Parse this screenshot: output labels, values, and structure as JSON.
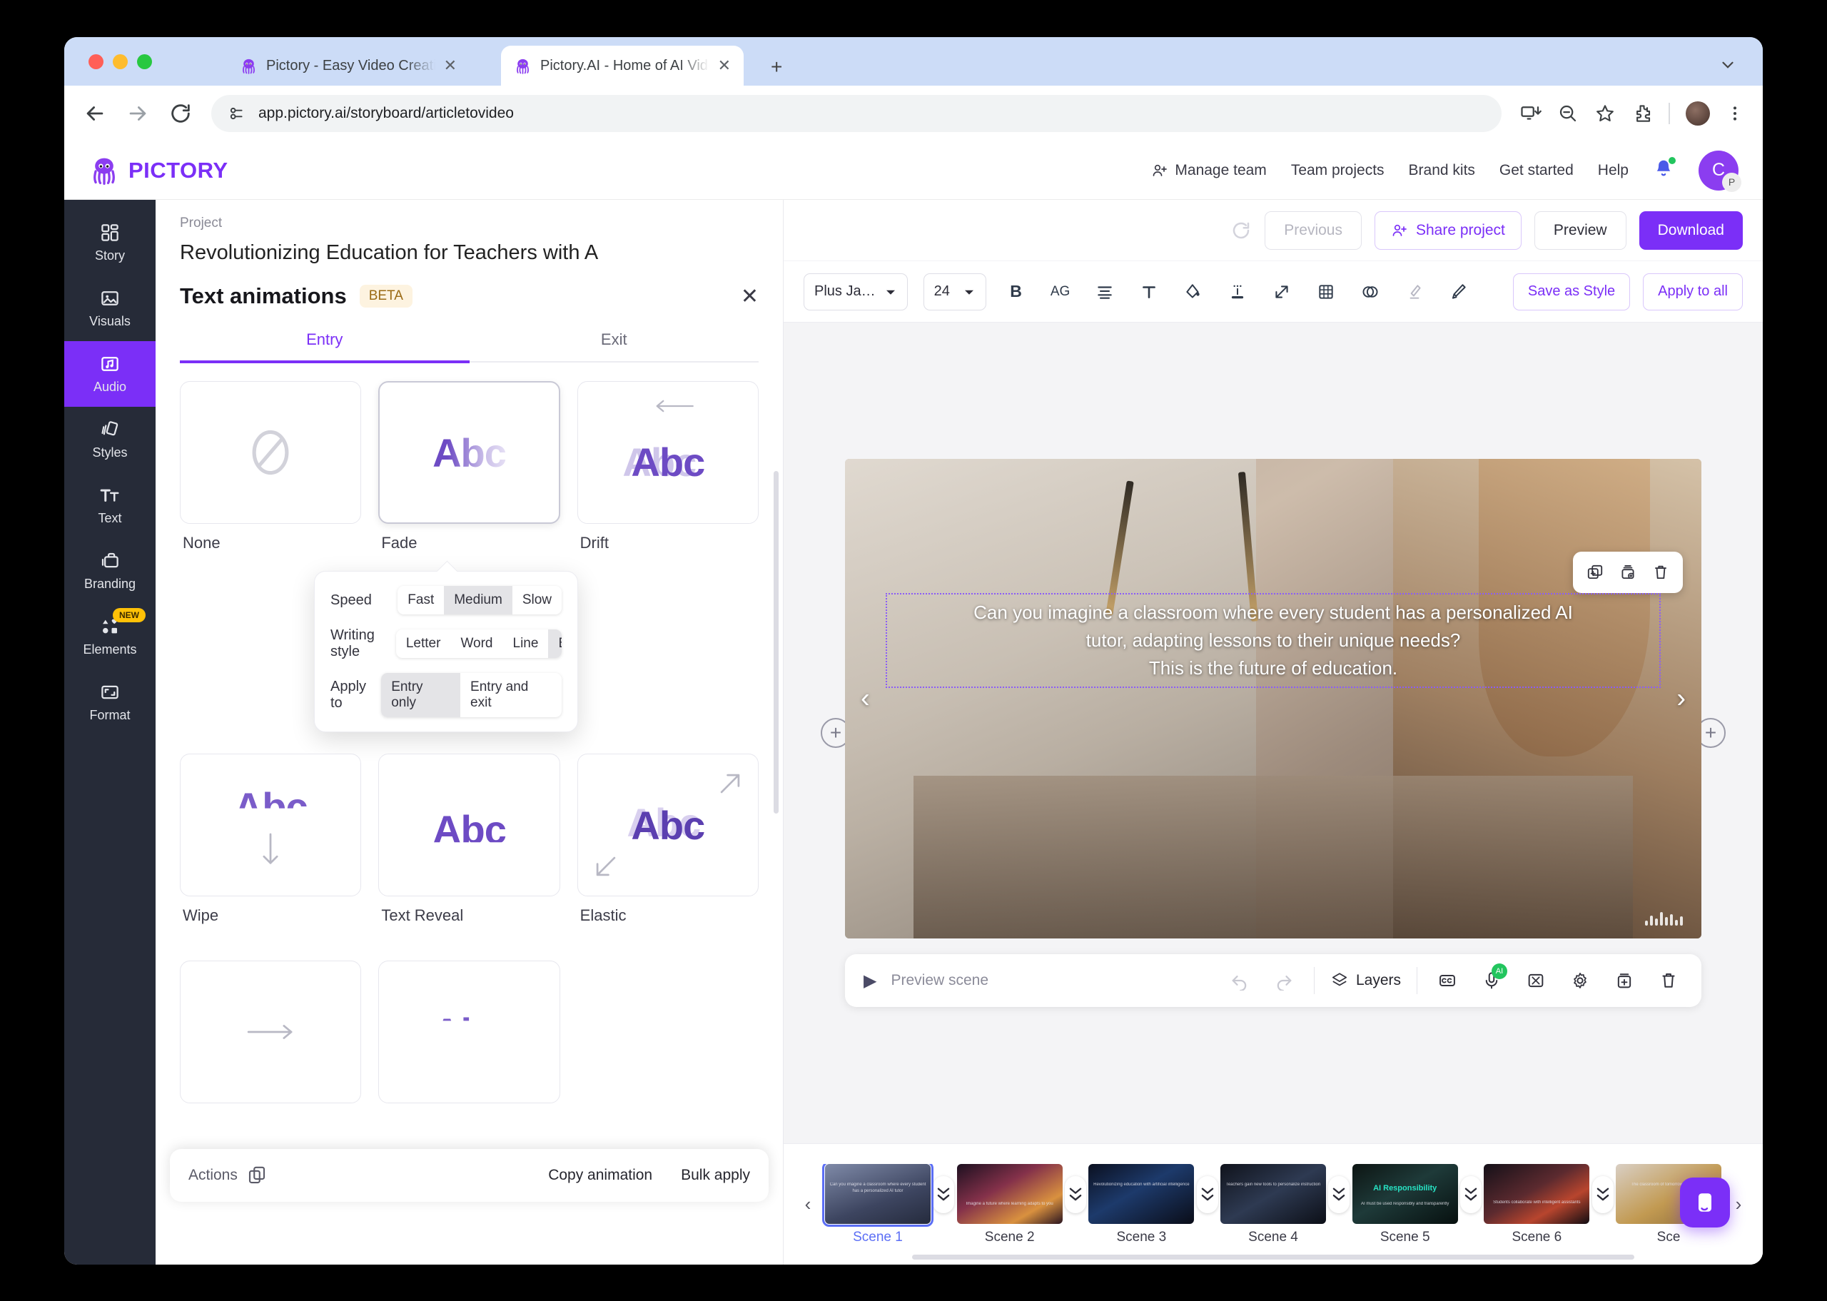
{
  "browser": {
    "tabs": [
      {
        "title": "Pictory - Easy Video Creation",
        "active": false
      },
      {
        "title": "Pictory.AI - Home of AI Video",
        "active": true
      }
    ],
    "newtab_label": "+",
    "url": "app.pictory.ai/storyboard/articletovideo",
    "back_icon": "back-arrow-icon",
    "forward_icon": "forward-arrow-icon",
    "reload_icon": "reload-icon",
    "site_info_icon": "site-settings-icon",
    "install_icon": "install-app-icon",
    "zoom_icon": "zoom-out-icon",
    "bookmark_icon": "star-icon",
    "extensions_icon": "puzzle-icon",
    "menu_icon": "kebab-menu-icon"
  },
  "header": {
    "brand": "PICTORY",
    "nav": [
      "Manage team",
      "Team projects",
      "Brand kits",
      "Get started",
      "Help"
    ],
    "avatar_initial": "C",
    "avatar_sub": "P"
  },
  "project": {
    "kicker": "Project",
    "title": "Revolutionizing Education for Teachers with A",
    "previous_label": "Previous",
    "share_label": "Share project",
    "preview_label": "Preview",
    "download_label": "Download"
  },
  "rail": {
    "items": [
      {
        "label": "Story",
        "icon": "grid-icon",
        "active": false,
        "badge": ""
      },
      {
        "label": "Visuals",
        "icon": "image-icon",
        "active": false,
        "badge": ""
      },
      {
        "label": "Audio",
        "icon": "music-icon",
        "active": true,
        "badge": ""
      },
      {
        "label": "Styles",
        "icon": "cards-icon",
        "active": false,
        "badge": ""
      },
      {
        "label": "Text",
        "icon": "text-size-icon",
        "active": false,
        "badge": ""
      },
      {
        "label": "Branding",
        "icon": "briefcase-icon",
        "active": false,
        "badge": ""
      },
      {
        "label": "Elements",
        "icon": "shapes-icon",
        "active": false,
        "badge": "NEW"
      },
      {
        "label": "Format",
        "icon": "frame-icon",
        "active": false,
        "badge": ""
      }
    ]
  },
  "panel": {
    "title": "Text animations",
    "beta": "BETA",
    "close_icon": "close-icon",
    "tabs": [
      {
        "label": "Entry",
        "active": true
      },
      {
        "label": "Exit",
        "active": false
      }
    ],
    "cards_row1": [
      {
        "label": "None",
        "glyph": "",
        "selected": false
      },
      {
        "label": "Fade",
        "glyph": "Abc",
        "selected": true
      },
      {
        "label": "Drift",
        "glyph": "Abc",
        "selected": false
      }
    ],
    "cards_row2": [
      {
        "label": "Wipe",
        "glyph": "Abc",
        "selected": false
      },
      {
        "label": "Text Reveal",
        "glyph": "Abc",
        "selected": false
      },
      {
        "label": "Elastic",
        "glyph": "Abc",
        "selected": false
      }
    ],
    "settings": {
      "speed_label": "Speed",
      "speed_options": [
        "Fast",
        "Medium",
        "Slow"
      ],
      "speed_value": "Medium",
      "writing_label": "Writing style",
      "writing_options": [
        "Letter",
        "Word",
        "Line",
        "Box"
      ],
      "writing_value": "Box",
      "applyto_label": "Apply to",
      "applyto_options": [
        "Entry only",
        "Entry and exit"
      ],
      "applyto_value": "Entry only"
    },
    "actions_label": "Actions",
    "copy_animation_label": "Copy animation",
    "bulk_apply_label": "Bulk apply"
  },
  "toolbar": {
    "font_family": "Plus Ja…",
    "font_size": "24",
    "bold_label": "B",
    "case_label": "AG",
    "icons": [
      "align-icon",
      "text-style-icon",
      "fill-color-icon",
      "highlight-icon",
      "spacing-icon",
      "grid-icon",
      "opacity-icon",
      "eraser-icon",
      "brush-icon"
    ],
    "save_as_style": "Save as Style",
    "apply_to_all": "Apply to all"
  },
  "canvas": {
    "caption_lines": [
      "Can you imagine a classroom where every student has a personalized AI",
      "tutor, adapting lessons to their unique needs?",
      "This is the future of education."
    ],
    "overlay_icons": [
      "duplicate-icon",
      "layers-add-icon",
      "delete-icon"
    ],
    "prev_arrow": "‹",
    "next_arrow": "›",
    "add_scene_icon": "plus-circle-icon",
    "waveform_icon": "waveform-icon"
  },
  "scenebar": {
    "play_icon": "play-icon",
    "preview_label": "Preview scene",
    "undo_icon": "undo-icon",
    "redo_icon": "redo-icon",
    "layers_label": "Layers",
    "layers_icon": "layers-icon",
    "tools": [
      {
        "icon": "closed-caption-icon",
        "badge": ""
      },
      {
        "icon": "microphone-icon",
        "badge": "AI"
      },
      {
        "icon": "scissors-icon",
        "badge": ""
      },
      {
        "icon": "settings-gear-icon",
        "badge": ""
      },
      {
        "icon": "duplicate-scene-icon",
        "badge": ""
      },
      {
        "icon": "delete-scene-icon",
        "badge": ""
      }
    ]
  },
  "strip": {
    "prev_icon": "chevron-left-icon",
    "next_icon": "chevron-right-icon",
    "scenes": [
      {
        "label": "Scene 1",
        "active": true,
        "caption": "Can you imagine a classroom where every student has a personalized AI tutor",
        "headline": ""
      },
      {
        "label": "Scene 2",
        "active": false,
        "caption": "Imagine a future where learning adapts to you",
        "headline": ""
      },
      {
        "label": "Scene 3",
        "active": false,
        "caption": "Revolutionizing education with artificial intelligence",
        "headline": ""
      },
      {
        "label": "Scene 4",
        "active": false,
        "caption": "Teachers gain new tools to personalize instruction",
        "headline": ""
      },
      {
        "label": "Scene 5",
        "active": false,
        "caption": "AI must be used responsibly and transparently",
        "headline": "AI Responsibility"
      },
      {
        "label": "Scene 6",
        "active": false,
        "caption": "Students collaborate with intelligent assistants",
        "headline": ""
      },
      {
        "label": "Sce",
        "active": false,
        "caption": "The classroom of tomorrow starts today",
        "headline": ""
      }
    ]
  },
  "chat": {
    "icon": "chat-bubble-icon"
  },
  "colors": {
    "accent": "#7B2FF7",
    "rail_bg": "#262b38",
    "beta_bg": "#fdf3e0",
    "active_scene": "#5b6ef5"
  }
}
